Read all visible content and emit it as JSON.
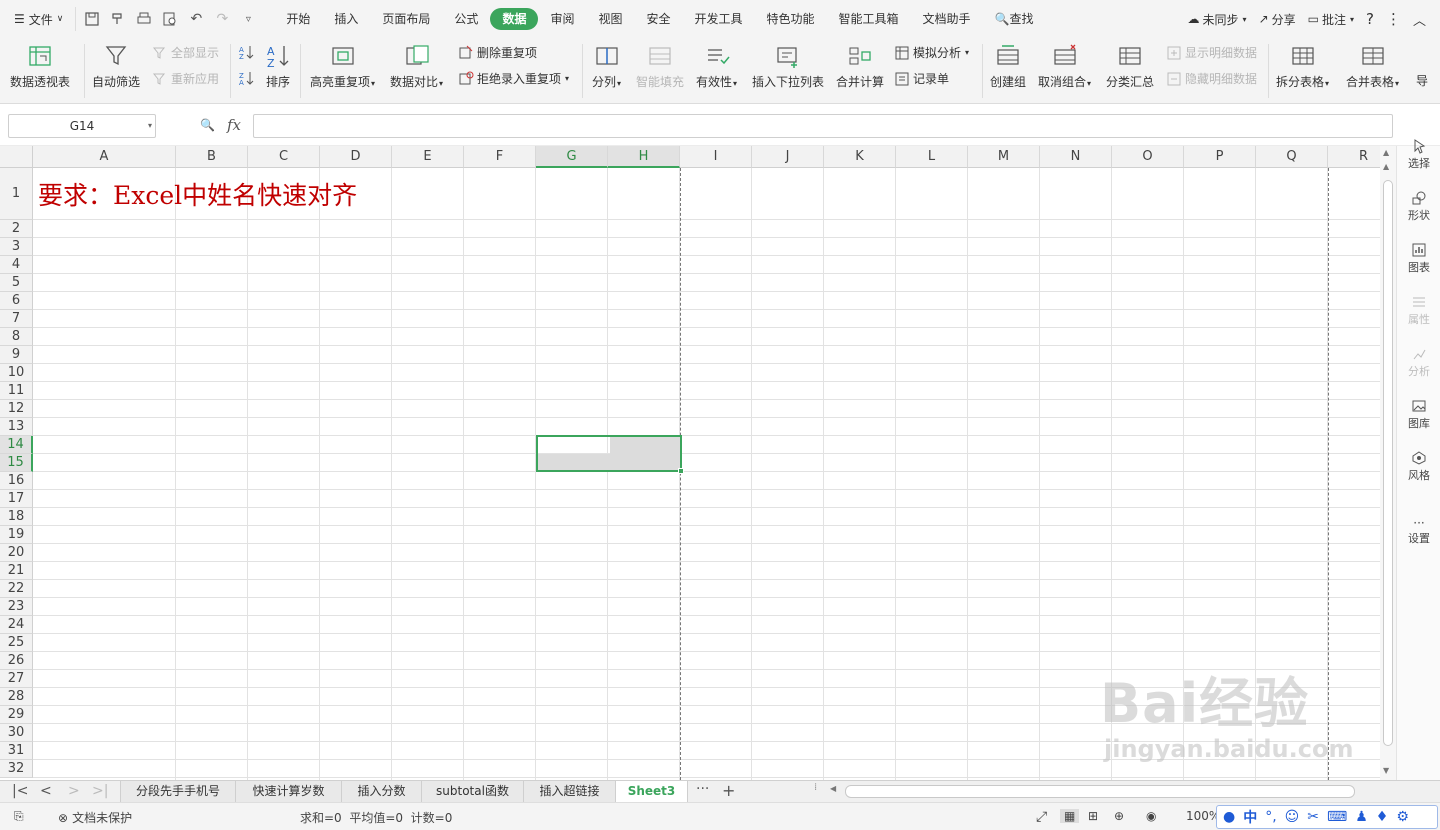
{
  "menubar": {
    "file_label": "文件",
    "tabs": [
      {
        "label": "开始",
        "active": false
      },
      {
        "label": "插入",
        "active": false
      },
      {
        "label": "页面布局",
        "active": false
      },
      {
        "label": "公式",
        "active": false
      },
      {
        "label": "数据",
        "active": true
      },
      {
        "label": "审阅",
        "active": false
      },
      {
        "label": "视图",
        "active": false
      },
      {
        "label": "安全",
        "active": false
      },
      {
        "label": "开发工具",
        "active": false
      },
      {
        "label": "特色功能",
        "active": false
      },
      {
        "label": "智能工具箱",
        "active": false
      },
      {
        "label": "文档助手",
        "active": false
      }
    ],
    "search_label": "查找",
    "sync_label": "未同步",
    "share_label": "分享",
    "review_label": "批注"
  },
  "ribbon": {
    "pivot": "数据透视表",
    "autofilter": "自动筛选",
    "show_all": "全部显示",
    "reapply": "重新应用",
    "sort": "排序",
    "highlight_dup": "高亮重复项",
    "data_compare": "数据对比",
    "remove_dup": "删除重复项",
    "reject_dup": "拒绝录入重复项",
    "split": "分列",
    "smart_fill": "智能填充",
    "validity": "有效性",
    "insert_dropdown": "插入下拉列表",
    "consolidate": "合并计算",
    "whatif": "模拟分析",
    "record": "记录单",
    "create_group": "创建组",
    "ungroup": "取消组合",
    "subtotal": "分类汇总",
    "show_detail": "显示明细数据",
    "hide_detail": "隐藏明细数据",
    "split_table": "拆分表格",
    "merge_table": "合并表格",
    "more": "导"
  },
  "formula_bar": {
    "name_box": "G14",
    "fx_label": "fx",
    "formula": ""
  },
  "sidepanel": {
    "select": "选择",
    "shape": "形状",
    "chart": "图表",
    "property": "属性",
    "analysis": "分析",
    "gallery": "图库",
    "style": "风格",
    "settings": "设置"
  },
  "sheet": {
    "columns": [
      "A",
      "B",
      "C",
      "D",
      "E",
      "F",
      "G",
      "H",
      "I",
      "J",
      "K",
      "L",
      "M",
      "N",
      "O",
      "P",
      "Q",
      "R"
    ],
    "selected_columns": [
      "G",
      "H"
    ],
    "rows": [
      "1",
      "2",
      "3",
      "4",
      "5",
      "6",
      "7",
      "8",
      "9",
      "10",
      "11",
      "12",
      "13",
      "14",
      "15",
      "16",
      "17",
      "18",
      "19",
      "20",
      "21",
      "22",
      "23",
      "24",
      "25",
      "26",
      "27",
      "28",
      "29",
      "30",
      "31",
      "32"
    ],
    "selected_rows": [
      "14",
      "15"
    ],
    "a1_text": "要求：Excel中姓名快速对齐",
    "title_color": "#c00000"
  },
  "sheet_tabs": [
    {
      "label": "分段先手手机号",
      "active": false
    },
    {
      "label": "快速计算岁数",
      "active": false
    },
    {
      "label": "插入分数",
      "active": false
    },
    {
      "label": "subtotal函数",
      "active": false
    },
    {
      "label": "插入超链接",
      "active": false
    },
    {
      "label": "Sheet3",
      "active": true
    }
  ],
  "statusbar": {
    "protect": "文档未保护",
    "summary": "求和=0  平均值=0  计数=0",
    "zoom": "100%",
    "ime": "中"
  },
  "watermark": {
    "line1": "Bai经验",
    "line2": "jingyan.baidu.com"
  },
  "accent_color": "#3ba55c"
}
